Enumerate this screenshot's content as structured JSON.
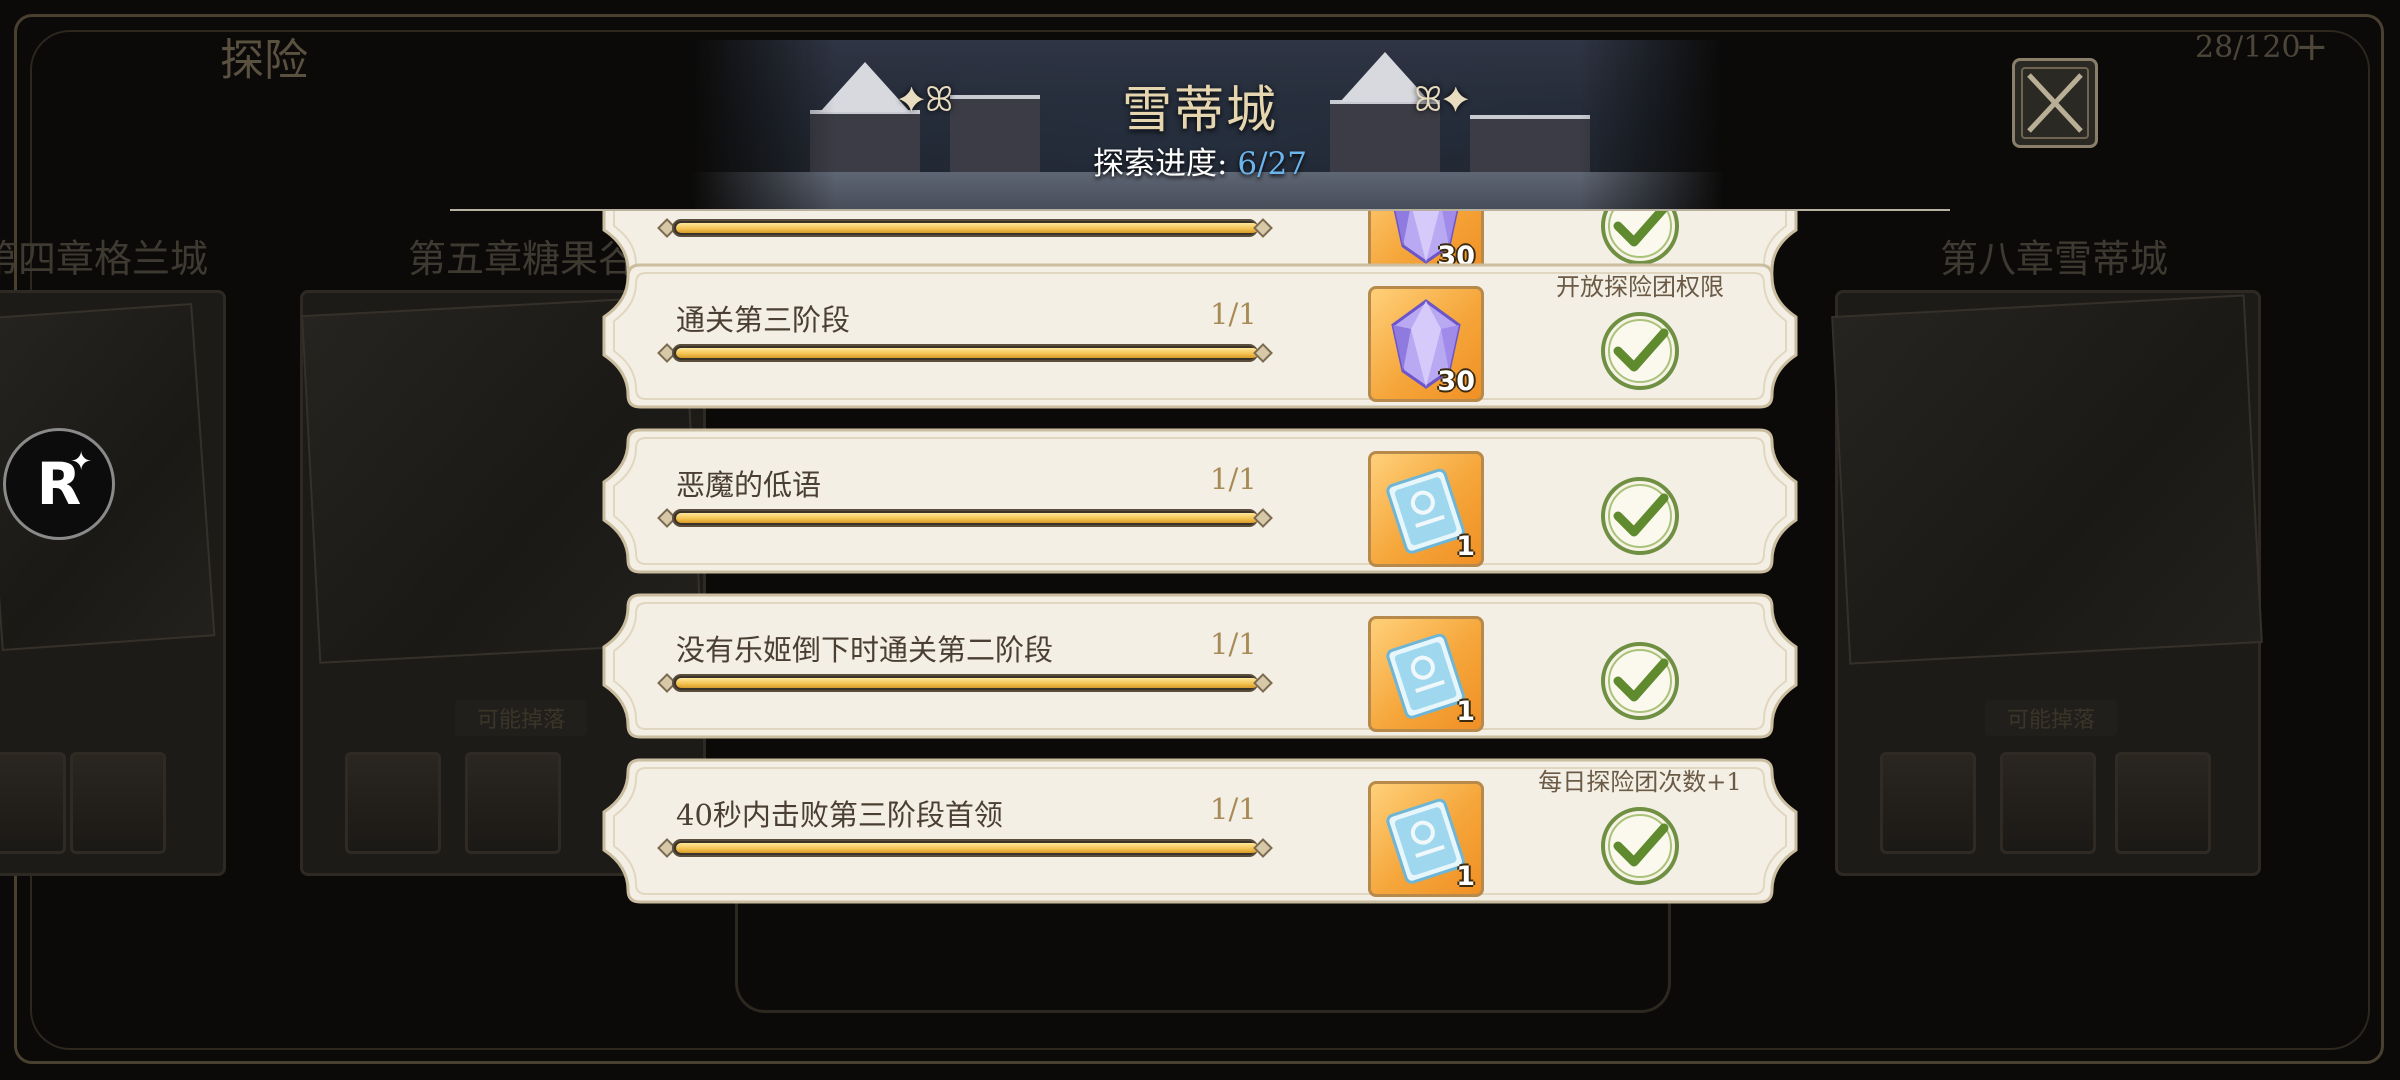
{
  "background": {
    "screen_title": "探险",
    "counter": "28/120",
    "chapters": [
      "第四章格兰城",
      "第五章糖果谷",
      "第八章雪蒂城"
    ],
    "card_label": "可能掉落"
  },
  "logo": {
    "text": "R",
    "star": "✦"
  },
  "header": {
    "title": "雪蒂城",
    "flourish_left": "✦ꕤ",
    "flourish_right": "ꕤ✦",
    "progress_label": "探索进度: ",
    "progress_value": "6/27"
  },
  "tasks": [
    {
      "label": "",
      "count": "",
      "progress": 1.0,
      "reward_icon": "diamond-icon",
      "reward_qty": "30",
      "note": "",
      "completed": true
    },
    {
      "label": "通关第三阶段",
      "count": "1/1",
      "progress": 1.0,
      "reward_icon": "diamond-icon",
      "reward_qty": "30",
      "note": "开放探险团权限",
      "completed": true
    },
    {
      "label": "恶魔的低语",
      "count": "1/1",
      "progress": 1.0,
      "reward_icon": "ticket-icon",
      "reward_qty": "1",
      "note": "",
      "completed": true
    },
    {
      "label": "没有乐姬倒下时通关第二阶段",
      "count": "1/1",
      "progress": 1.0,
      "reward_icon": "ticket-icon",
      "reward_qty": "1",
      "note": "",
      "completed": true
    },
    {
      "label": "40秒内击败第三阶段首领",
      "count": "1/1",
      "progress": 1.0,
      "reward_icon": "ticket-icon",
      "reward_qty": "1",
      "note": "每日探险团次数+1",
      "completed": true
    }
  ],
  "colors": {
    "accent_blue": "#6cb5ec",
    "card_bg": "#f3efe4",
    "check_green": "#7a9c4a",
    "reward_orange": "#f5a63a"
  }
}
